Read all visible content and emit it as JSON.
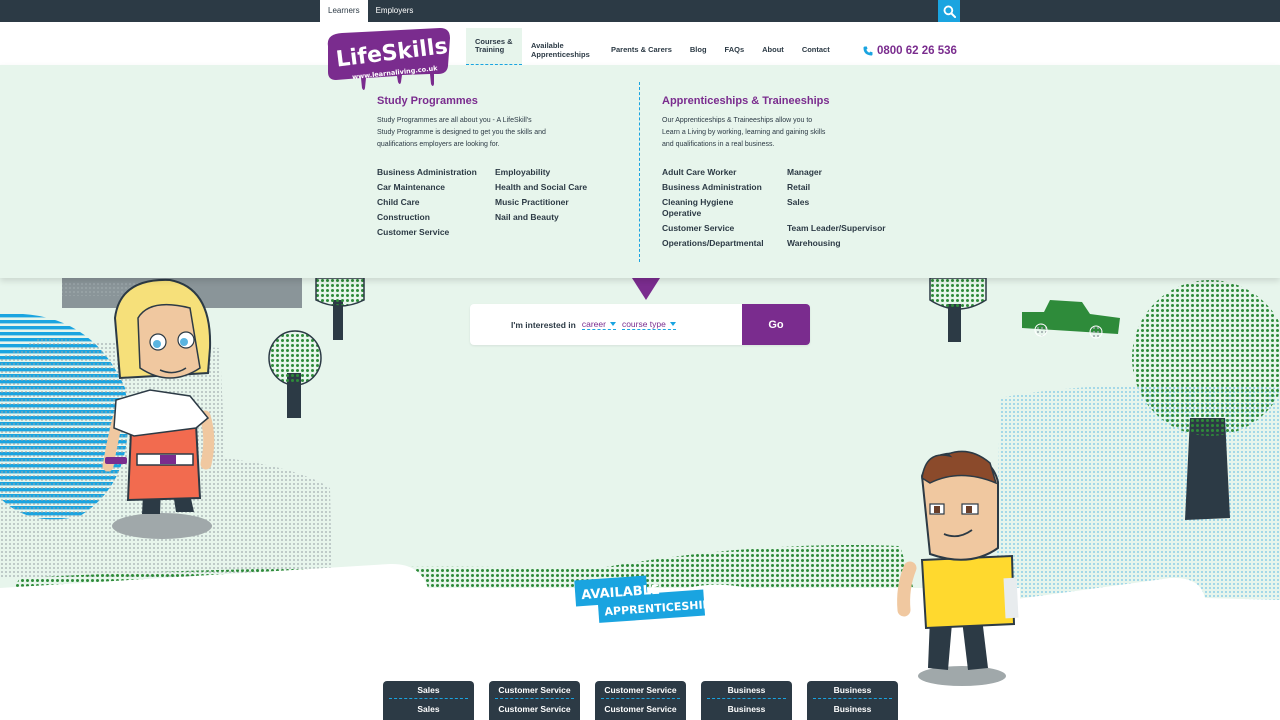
{
  "topbar": {
    "tabs": [
      {
        "label": "Learners"
      },
      {
        "label": "Employers"
      }
    ]
  },
  "logo": {
    "brand": "LifeSkills",
    "url": "www.learnaliving.co.uk"
  },
  "nav": {
    "items": [
      {
        "label": "Courses & Training"
      },
      {
        "label": "Available Apprenticeships"
      },
      {
        "label": "Parents & Carers"
      },
      {
        "label": "Blog"
      },
      {
        "label": "FAQs"
      },
      {
        "label": "About"
      },
      {
        "label": "Contact"
      }
    ],
    "phone": "0800 62 26 536"
  },
  "mega": {
    "study": {
      "title": "Study Programmes",
      "description": "Study Programmes are all about you - A LifeSkill's Study Programme is designed to get you the skills and qualifications employers are looking for.",
      "links": [
        "Business Administration",
        "Employability",
        "Car Maintenance",
        "Health and Social Care",
        "Child Care",
        "Music Practitioner",
        "Construction",
        "Nail and Beauty",
        "Customer Service"
      ]
    },
    "apprenticeships": {
      "title": "Apprenticeships & Traineeships",
      "description": "Our Apprenticeships & Traineeships allow you to Learn a Living by working, learning and gaining skills and qualifications in a real business.",
      "links": [
        "Adult Care Worker",
        "Manager",
        "Business Administration",
        "Retail",
        "Cleaning Hygiene Operative",
        "Sales",
        "Customer Service",
        "Team Leader/Supervisor",
        "Operations/Departmental",
        "Warehousing"
      ]
    }
  },
  "finder": {
    "label": "I'm interested in",
    "career": "career",
    "course_type": "course type",
    "go": "Go"
  },
  "badge": {
    "line1": "AVAILABLE",
    "line2": "APPRENTICESHIPS"
  },
  "cards": [
    {
      "title": "Sales",
      "sub": "Sales"
    },
    {
      "title": "Customer Service",
      "sub": "Customer Service"
    },
    {
      "title": "Customer Service",
      "sub": "Customer Service"
    },
    {
      "title": "Business",
      "sub": "Business"
    },
    {
      "title": "Business",
      "sub": "Business"
    }
  ],
  "colors": {
    "purple": "#7a2c8e",
    "navy": "#2c3a45",
    "blue": "#1aa4e0",
    "mint": "#e7f5ec",
    "green": "#2e8b3a",
    "yellow": "#ffd92e"
  }
}
